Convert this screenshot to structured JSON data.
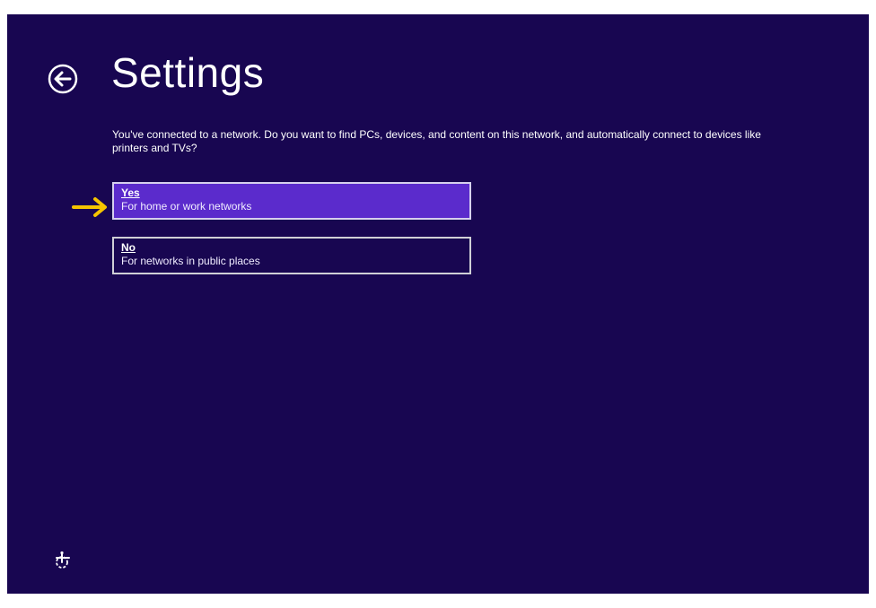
{
  "page": {
    "title": "Settings",
    "prompt": "You've connected to a network. Do you want to find PCs, devices, and content on this network, and automatically connect to devices like printers and TVs?"
  },
  "options": [
    {
      "title": "Yes",
      "description": "For home or work networks",
      "selected": true
    },
    {
      "title": "No",
      "description": "For networks in public places",
      "selected": false
    }
  ],
  "icons": {
    "back": "back-arrow-circle-icon",
    "pointer": "arrow-right-icon",
    "accessibility": "ease-of-access-icon"
  },
  "colors": {
    "background": "#180651",
    "selected_option": "#5b2bcc",
    "pointer_arrow": "#f5c400",
    "text": "#ffffff"
  }
}
